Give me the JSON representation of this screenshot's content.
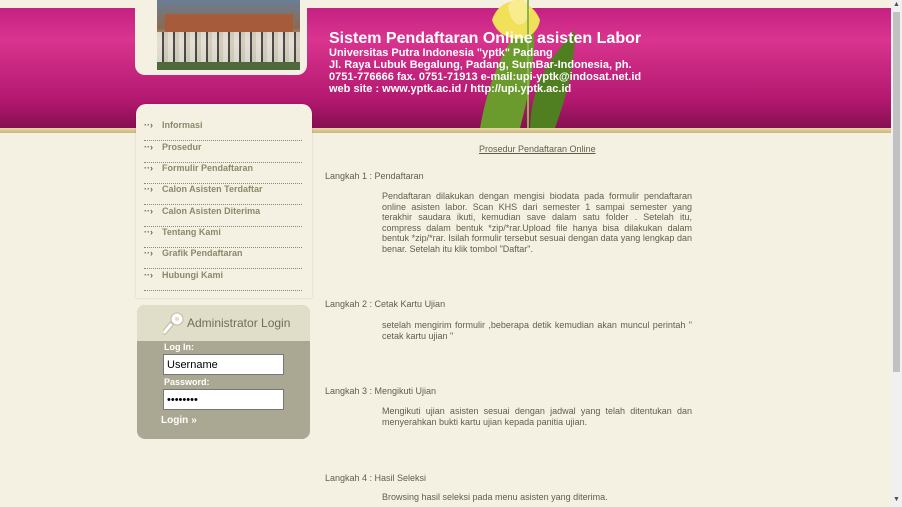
{
  "header": {
    "title": "Sistem Pendaftaran Online asisten Labor",
    "line1": "Universitas Putra Indonesia \"yptk\" Padang",
    "line2": "Jl. Raya Lubuk Begalung, Padang, SumBar-Indonesia, ph. 0751-776666 fax. 0751-71913 e-mail:upi-yptk@indosat.net.id web site : www.yptk.ac.id / http://upi.yptk.ac.id"
  },
  "nav": {
    "items": [
      {
        "label": "Informasi"
      },
      {
        "label": "Prosedur"
      },
      {
        "label": "Formulir Pendaftaran"
      },
      {
        "label": "Calon Asisten Terdaftar"
      },
      {
        "label": "Calon Asisten Diterima"
      },
      {
        "label": "Tentang Kami"
      },
      {
        "label": "Grafik Pendaftaran"
      },
      {
        "label": "Hubungi Kami"
      }
    ]
  },
  "login": {
    "title": "Administrator Login",
    "login_label": "Log In:",
    "username_value": "Username",
    "password_label": "Password:",
    "password_value": "••••••••",
    "button_label": "Login"
  },
  "content": {
    "title": "Prosedur Pendaftaran Online",
    "steps": [
      {
        "head": "Langkah 1 : Pendaftaran",
        "body": "Pendaftaran dilakukan dengan mengisi biodata pada formulir pendaftaran online asisten labor. Scan KHS dari semester 1 sampai semester yang terakhir saudara ikuti, kemudian save dalam satu folder . Setelah itu, compress dalam bentuk *zip/*rar.Upload file hanya bisa dilakukan dalam bentuk *zip/*rar. Isilah formulir tersebut sesuai dengan data yang lengkap dan benar. Setelah itu klik tombol \"Daftar\"."
      },
      {
        "head": "Langkah 2 : Cetak Kartu Ujian",
        "body": "setelah mengirim formulir ,beberapa detik kemudian akan muncul perintah \" cetak kartu ujian \""
      },
      {
        "head": "Langkah 3 : Mengikuti Ujian",
        "body": "Mengikuti ujian asisten sesuai dengan jadwal yang telah ditentukan dan menyerahkan bukti kartu ujian kepada panitia ujian."
      },
      {
        "head": "Langkah 4 : Hasil Seleksi",
        "body": "Browsing hasil seleksi pada menu asisten yang diterima."
      }
    ]
  }
}
